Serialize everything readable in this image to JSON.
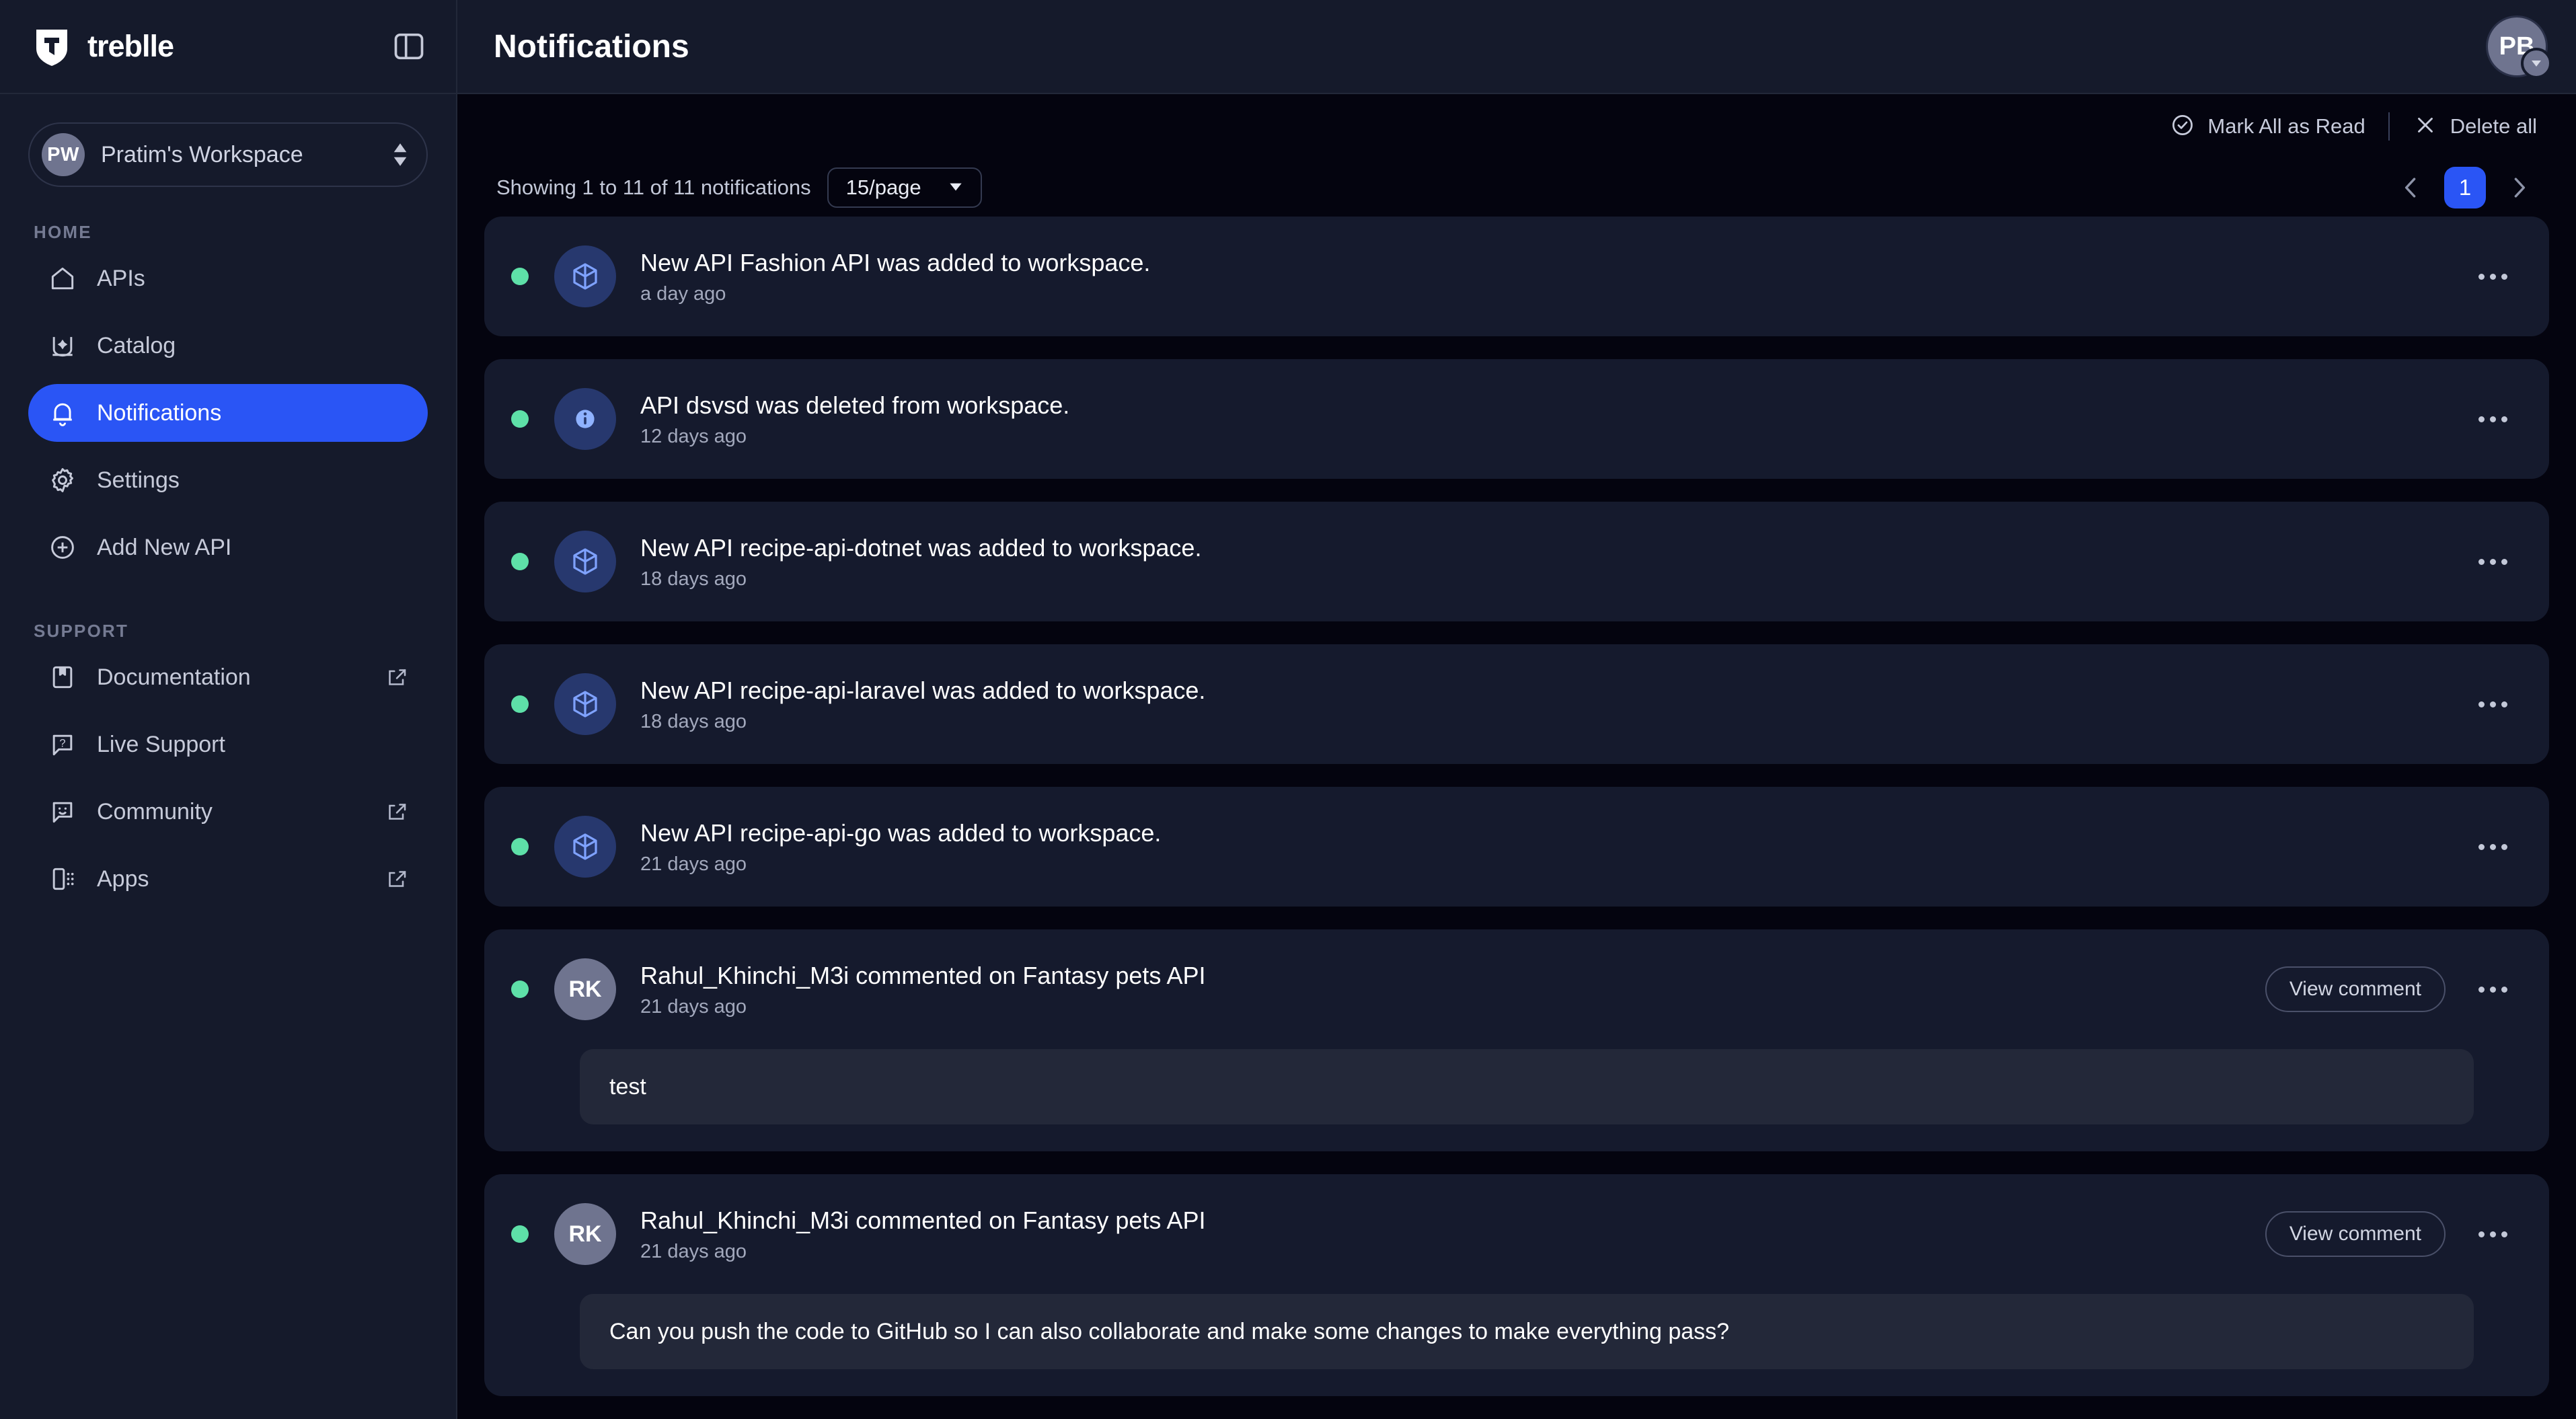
{
  "brand": {
    "name": "treblle",
    "logo_icon": "treblle-shield-logo"
  },
  "sidebar": {
    "panel_toggle_icon": "sidebar-toggle-icon",
    "workspace": {
      "initials": "PW",
      "name": "Pratim's Workspace",
      "caret_icon": "chevron-up-down-icon"
    },
    "sections": [
      {
        "label": "HOME",
        "items": [
          {
            "label": "APIs",
            "icon": "home-icon",
            "active": false,
            "external": false
          },
          {
            "label": "Catalog",
            "icon": "catalog-icon",
            "active": false,
            "external": false
          },
          {
            "label": "Notifications",
            "icon": "bell-icon",
            "active": true,
            "external": false
          },
          {
            "label": "Settings",
            "icon": "gear-icon",
            "active": false,
            "external": false
          },
          {
            "label": "Add New API",
            "icon": "plus-circle-icon",
            "active": false,
            "external": false
          }
        ]
      },
      {
        "label": "SUPPORT",
        "items": [
          {
            "label": "Documentation",
            "icon": "book-icon",
            "active": false,
            "external": true
          },
          {
            "label": "Live Support",
            "icon": "question-chat-icon",
            "active": false,
            "external": false
          },
          {
            "label": "Community",
            "icon": "smile-chat-icon",
            "active": false,
            "external": true
          },
          {
            "label": "Apps",
            "icon": "apps-grid-icon",
            "active": false,
            "external": true
          }
        ]
      }
    ]
  },
  "topbar": {
    "title": "Notifications",
    "user": {
      "initials": "PB",
      "caret_icon": "chevron-down-icon"
    }
  },
  "toolbar": {
    "mark_all_label": "Mark All as Read",
    "mark_all_icon": "check-circle-icon",
    "delete_all_label": "Delete all",
    "delete_all_icon": "close-x-icon"
  },
  "meta": {
    "showing_text": "Showing 1 to 11 of 11 notifications",
    "page_size_value": "15/page",
    "page_size_caret_icon": "caret-down-icon",
    "pager": {
      "prev_icon": "chevron-left-icon",
      "next_icon": "chevron-right-icon",
      "current_page": "1"
    }
  },
  "colors": {
    "accent": "#2a55f5",
    "unread_dot": "#5ee0a8",
    "sidebar_bg": "#151a2b",
    "card_bg": "#151a2d",
    "page_bg": "#04040f",
    "bubble_bg": "#232839"
  },
  "notifications": [
    {
      "unread": true,
      "avatar_kind": "api",
      "avatar_icon": "cube-box-icon",
      "avatar_text": "",
      "title": "New API Fashion API was added to workspace.",
      "time": "a day ago",
      "has_view_comment": false,
      "view_comment_label": "View comment",
      "menu_icon": "more-horizontal-icon",
      "comment": null
    },
    {
      "unread": true,
      "avatar_kind": "info",
      "avatar_icon": "info-circle-icon",
      "avatar_text": "",
      "title": "API dsvsd was deleted from workspace.",
      "time": "12 days ago",
      "has_view_comment": false,
      "view_comment_label": "View comment",
      "menu_icon": "more-horizontal-icon",
      "comment": null
    },
    {
      "unread": true,
      "avatar_kind": "api",
      "avatar_icon": "cube-box-icon",
      "avatar_text": "",
      "title": "New API recipe-api-dotnet was added to workspace.",
      "time": "18 days ago",
      "has_view_comment": false,
      "view_comment_label": "View comment",
      "menu_icon": "more-horizontal-icon",
      "comment": null
    },
    {
      "unread": true,
      "avatar_kind": "api",
      "avatar_icon": "cube-box-icon",
      "avatar_text": "",
      "title": "New API recipe-api-laravel was added to workspace.",
      "time": "18 days ago",
      "has_view_comment": false,
      "view_comment_label": "View comment",
      "menu_icon": "more-horizontal-icon",
      "comment": null
    },
    {
      "unread": true,
      "avatar_kind": "api",
      "avatar_icon": "cube-box-icon",
      "avatar_text": "",
      "title": "New API recipe-api-go was added to workspace.",
      "time": "21 days ago",
      "has_view_comment": false,
      "view_comment_label": "View comment",
      "menu_icon": "more-horizontal-icon",
      "comment": null
    },
    {
      "unread": true,
      "avatar_kind": "user",
      "avatar_icon": "",
      "avatar_text": "RK",
      "title": "Rahul_Khinchi_M3i commented on Fantasy pets API",
      "time": "21 days ago",
      "has_view_comment": true,
      "view_comment_label": "View comment",
      "menu_icon": "more-horizontal-icon",
      "comment": "test"
    },
    {
      "unread": true,
      "avatar_kind": "user",
      "avatar_icon": "",
      "avatar_text": "RK",
      "title": "Rahul_Khinchi_M3i commented on Fantasy pets API",
      "time": "21 days ago",
      "has_view_comment": true,
      "view_comment_label": "View comment",
      "menu_icon": "more-horizontal-icon",
      "comment": "Can you push the code to GitHub so I can also collaborate and make some changes to make everything pass?"
    }
  ]
}
